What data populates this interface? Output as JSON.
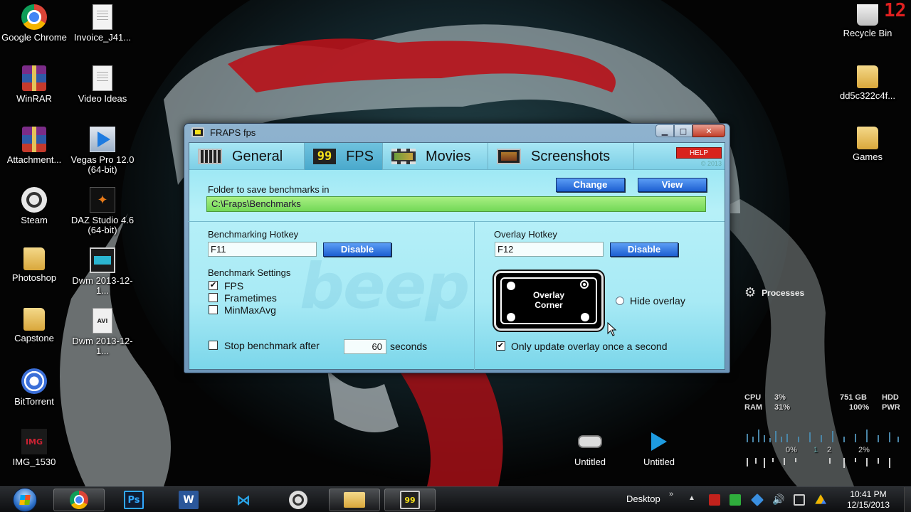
{
  "corner_number": "12",
  "desktop": {
    "icons": [
      {
        "label": "Google Chrome",
        "icon": "chrome-icon"
      },
      {
        "label": "Invoice_J41...",
        "icon": "document-icon"
      },
      {
        "label": "WinRAR",
        "icon": "winrar-icon"
      },
      {
        "label": "Video Ideas",
        "icon": "document-icon"
      },
      {
        "label": "Attachment...",
        "icon": "winrar-icon"
      },
      {
        "label": "Vegas Pro 12.0 (64-bit)",
        "icon": "vegas-icon"
      },
      {
        "label": "Steam",
        "icon": "steam-icon"
      },
      {
        "label": "DAZ Studio 4.6 (64-bit)",
        "icon": "daz-icon"
      },
      {
        "label": "Photoshop",
        "icon": "folder-icon"
      },
      {
        "label": "Dwm 2013-12-1...",
        "icon": "video-icon"
      },
      {
        "label": "Capstone",
        "icon": "folder-icon"
      },
      {
        "label": "Dwm 2013-12-1...",
        "icon": "avi-icon"
      },
      {
        "label": "BitTorrent",
        "icon": "bittorrent-icon"
      },
      {
        "label": "IMG_1530",
        "icon": "image-icon"
      },
      {
        "label": "Untitled",
        "icon": "untitled-icon"
      },
      {
        "label": "Untitled",
        "icon": "vegas-project-icon"
      },
      {
        "label": "Recycle Bin",
        "icon": "recycle-bin-icon"
      },
      {
        "label": "dd5c322c4f...",
        "icon": "folder-icon"
      },
      {
        "label": "Games",
        "icon": "folder-icon"
      }
    ]
  },
  "fraps": {
    "title": "FRAPS fps",
    "controls": {
      "minimize": "▁",
      "maximize": "□",
      "close": "✕"
    },
    "tabs": [
      {
        "label": "General",
        "icon": "general-tab-icon"
      },
      {
        "label": "FPS",
        "icon": "fps-tab-icon",
        "badge": "99"
      },
      {
        "label": "Movies",
        "icon": "movies-tab-icon"
      },
      {
        "label": "Screenshots",
        "icon": "screenshots-tab-icon"
      }
    ],
    "active_tab": "FPS",
    "help_label": "HELP",
    "copyright": "© 2013",
    "watermark": "beep",
    "folder_label": "Folder to save benchmarks in",
    "change_label": "Change",
    "view_label": "View",
    "folder_path": "C:\\Fraps\\Benchmarks",
    "benchmark_hotkey_label": "Benchmarking Hotkey",
    "benchmark_hotkey_value": "F11",
    "overlay_hotkey_label": "Overlay Hotkey",
    "overlay_hotkey_value": "F12",
    "disable_label": "Disable",
    "benchmark_settings_label": "Benchmark Settings",
    "settings": [
      {
        "label": "FPS",
        "checked": true
      },
      {
        "label": "Frametimes",
        "checked": false
      },
      {
        "label": "MinMaxAvg",
        "checked": false
      }
    ],
    "stop_label": "Stop benchmark after",
    "stop_checked": false,
    "stop_value": "60",
    "seconds_label": "seconds",
    "overlay_corner_line1": "Overlay",
    "overlay_corner_line2": "Corner",
    "overlay_selected_corner": "top-right",
    "hide_overlay_label": "Hide overlay",
    "hide_overlay_checked": false,
    "update_label": "Only update overlay once a second",
    "update_checked": true
  },
  "widgets": {
    "processes_label": "Processes",
    "cpu_label": "CPU",
    "cpu_value": "3%",
    "ram_label": "RAM",
    "ram_value": "31%",
    "hdd_value": "751 GB",
    "hdd_label": "HDD",
    "pwr_value": "100%",
    "pwr_label": "PWR",
    "net_left": "0%",
    "net_mid1": "1",
    "net_mid2": "2",
    "net_right": "2%"
  },
  "taskbar": {
    "pinned": [
      {
        "name": "chrome",
        "icon": "chrome-icon",
        "running": true
      },
      {
        "name": "photoshop",
        "icon": "photoshop-icon",
        "text": "Ps",
        "running": false
      },
      {
        "name": "word",
        "icon": "word-icon",
        "text": "W",
        "running": false
      },
      {
        "name": "visual-studio",
        "icon": "visual-studio-icon",
        "text": "⋈",
        "running": false
      },
      {
        "name": "steam",
        "icon": "steam-icon",
        "running": false
      },
      {
        "name": "explorer",
        "icon": "folder-icon",
        "running": true
      },
      {
        "name": "fraps",
        "icon": "fraps-icon",
        "text": "99",
        "running": true
      }
    ],
    "desktop_label": "Desktop",
    "chevron": "»",
    "up_arrow": "▲",
    "time": "10:41 PM",
    "date": "12/15/2013"
  }
}
